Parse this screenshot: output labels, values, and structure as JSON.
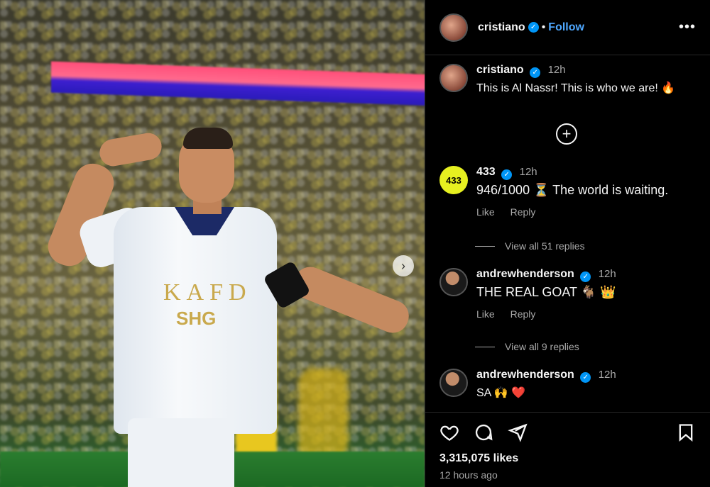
{
  "post": {
    "username": "cristiano",
    "follow_label": "Follow",
    "separator": "•",
    "more_label": "•••",
    "caption": {
      "username": "cristiano",
      "time": "12h",
      "text": "This is Al Nassr! This is who we are! 🔥"
    },
    "photo": {
      "jersey_text_1": "KAFD",
      "jersey_text_2": "SHG",
      "next_icon": "›"
    },
    "load_more_icon": "+",
    "comments": [
      {
        "username": "433",
        "avatar_text": "433",
        "time": "12h",
        "text": "946/1000 ⏳ The world is waiting.",
        "like_label": "Like",
        "reply_label": "Reply",
        "view_replies": "View all 51 replies"
      },
      {
        "username": "andrewhenderson",
        "time": "12h",
        "text": "THE REAL GOAT 🐐 👑",
        "like_label": "Like",
        "reply_label": "Reply",
        "view_replies": "View all 9 replies"
      },
      {
        "username": "andrewhenderson",
        "time": "12h",
        "text": "SA 🙌 ❤️"
      }
    ],
    "likes": "3,315,075 likes",
    "posted_ago": "12 hours ago"
  },
  "colors": {
    "accent": "#0095f6",
    "follow": "#4fa8ff",
    "muted": "#a8a8a8",
    "background": "#000000"
  },
  "icons": [
    "verified-icon",
    "more-options-icon",
    "next-image-icon",
    "load-more-comments-icon",
    "heart-icon",
    "comment-icon",
    "share-icon",
    "bookmark-icon"
  ]
}
